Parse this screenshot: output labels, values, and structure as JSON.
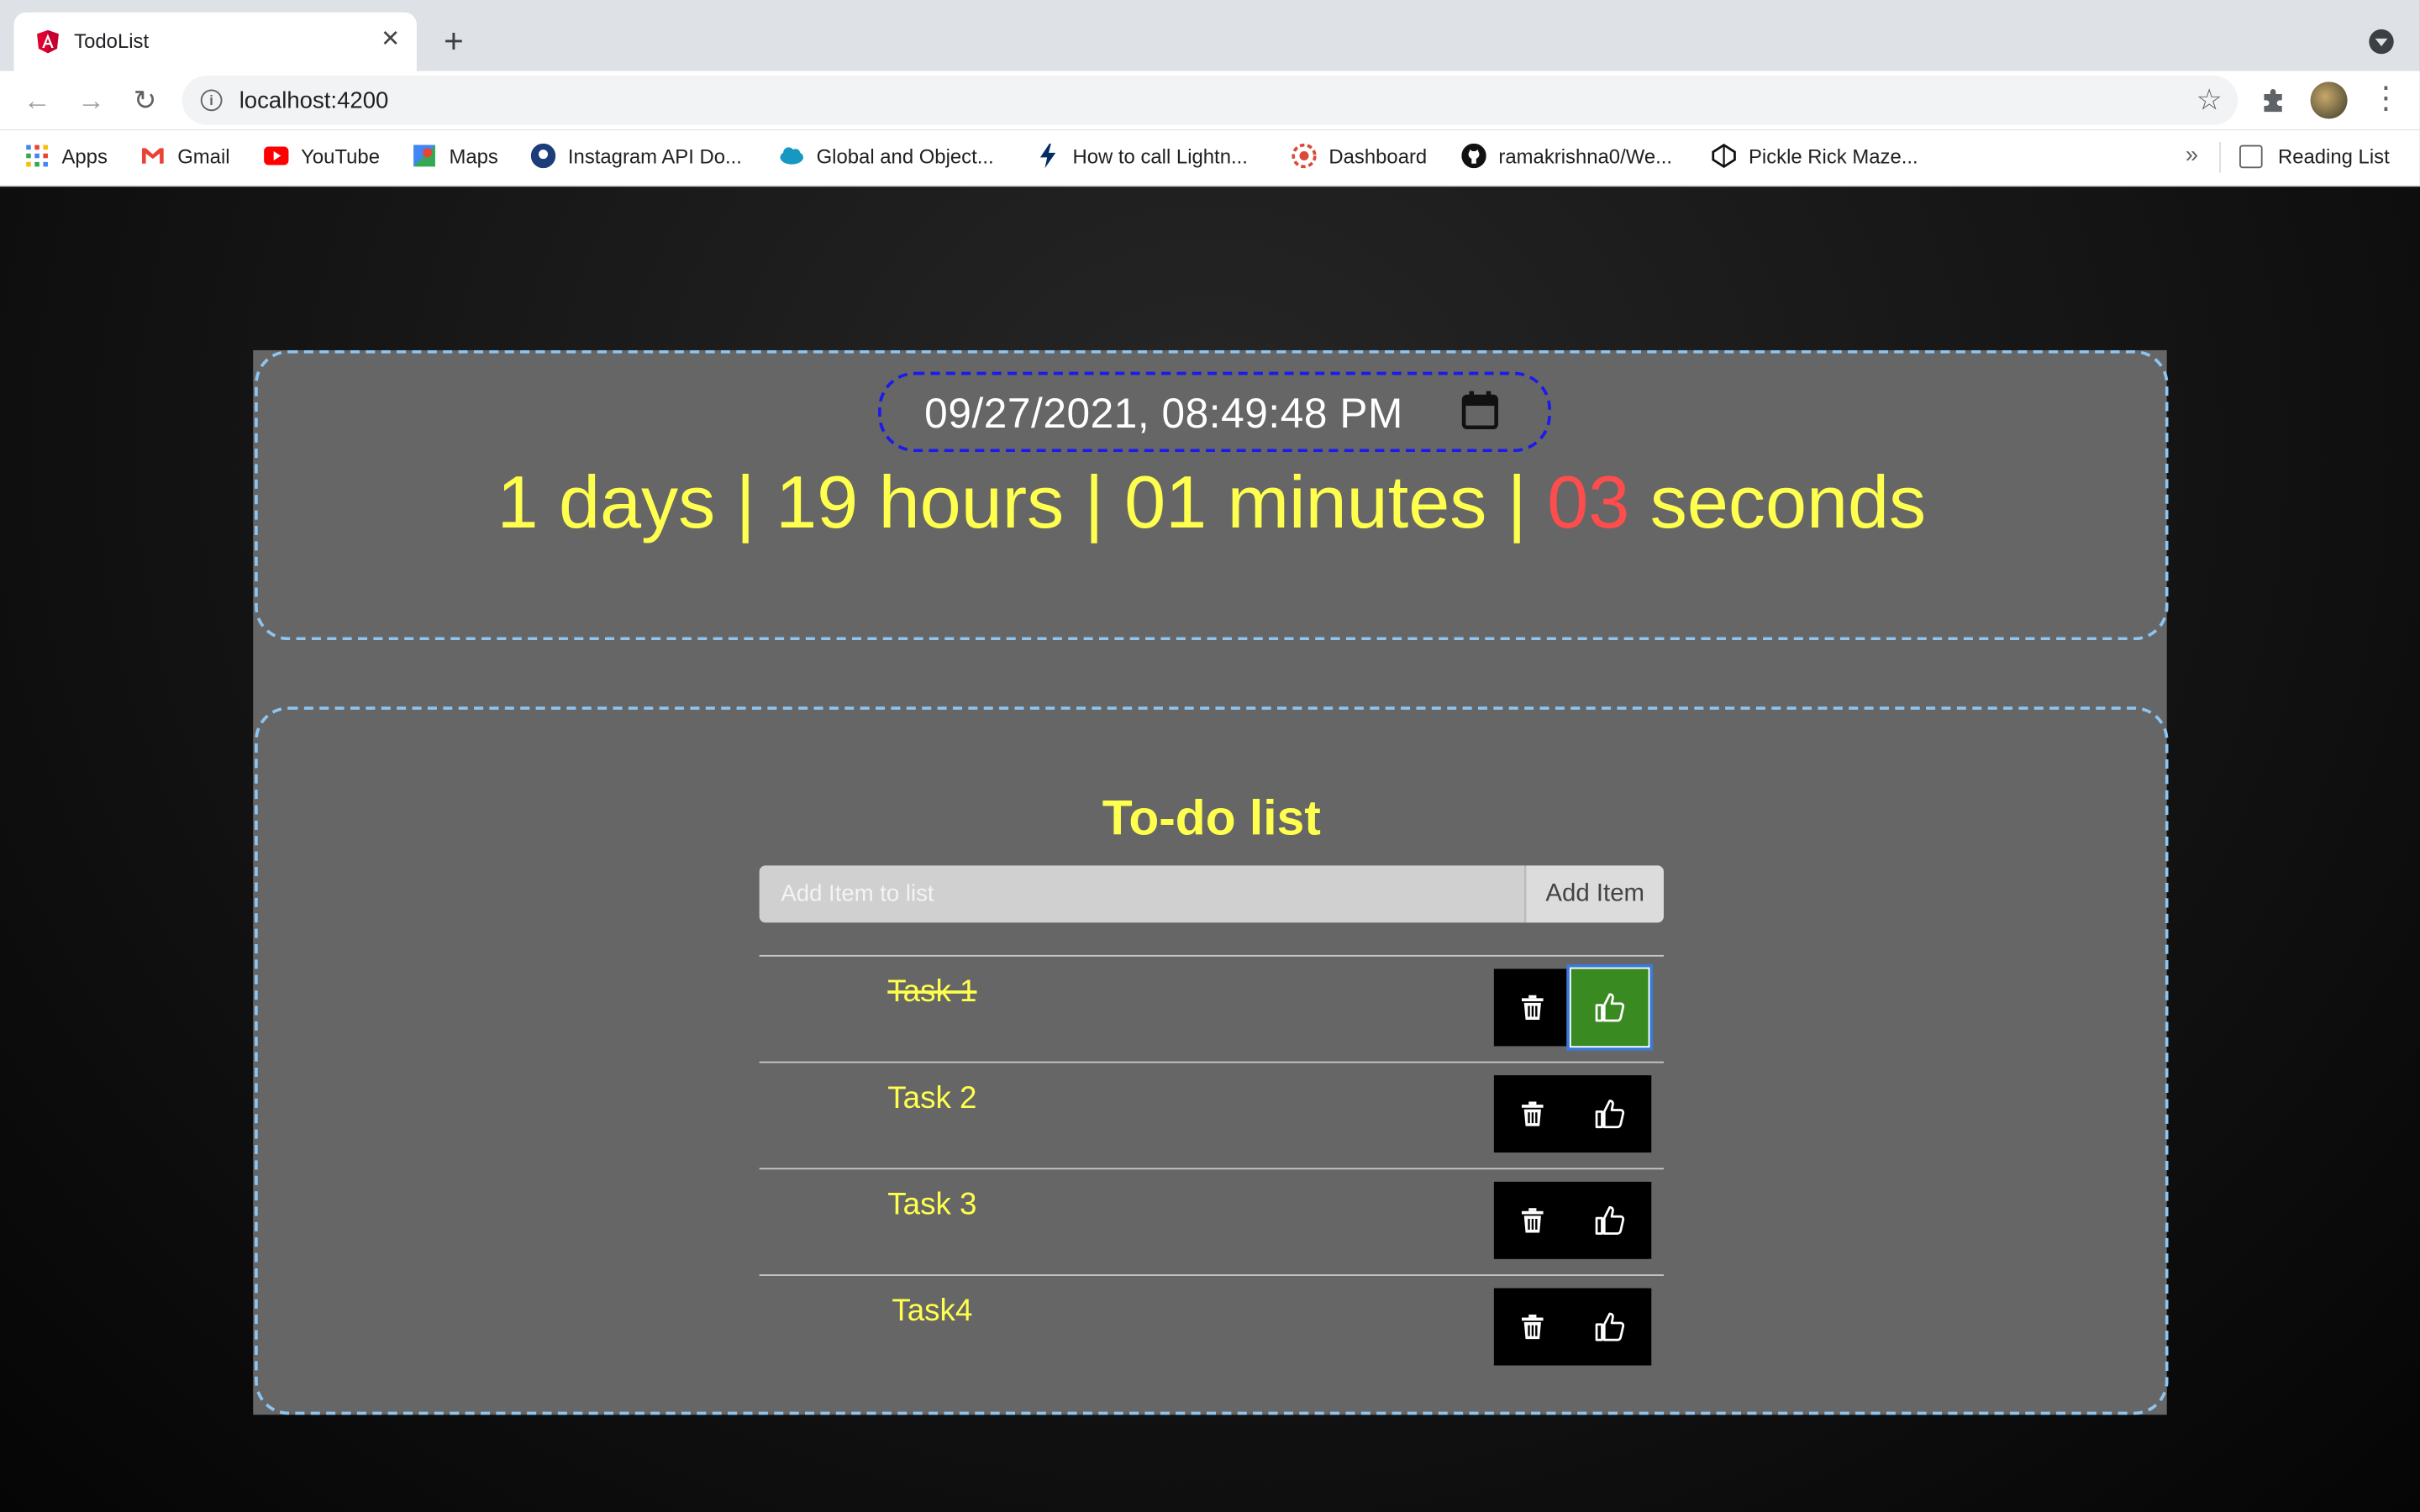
{
  "browser": {
    "tab_title": "TodoList",
    "url": "localhost:4200",
    "bookmarks": [
      "Apps",
      "Gmail",
      "YouTube",
      "Maps",
      "Instagram API Do...",
      "Global and Object...",
      "How to call Lightn...",
      "Dashboard",
      "ramakrishna0/We...",
      "Pickle Rick Maze..."
    ],
    "more_bookmarks": "»",
    "reading_list": "Reading List"
  },
  "timer": {
    "datetime": "09/27/2021, 08:49:48 PM",
    "days": "1 days | ",
    "hours": "19 hours | ",
    "minutes": "01 minutes | ",
    "seconds_value": "03",
    "seconds_label": " seconds"
  },
  "todo": {
    "title": "To-do list",
    "input_placeholder": "Add Item to list",
    "add_button": "Add Item",
    "tasks": [
      {
        "label": "Task 1",
        "done": true
      },
      {
        "label": "Task 2",
        "done": false
      },
      {
        "label": "Task 3",
        "done": false
      },
      {
        "label": "Task4",
        "done": false
      }
    ]
  },
  "colors": {
    "accent_text": "#ffff4d",
    "seconds_red": "#ff4d4d",
    "done_green": "#3a8a22",
    "panel_gray": "#666666"
  }
}
